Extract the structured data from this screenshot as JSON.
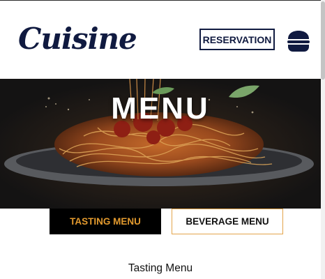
{
  "header": {
    "logo": "Cuisine",
    "reservation_label": "RESERVATION",
    "menu_icon": "hamburger-icon"
  },
  "hero": {
    "title": "MENU",
    "image": "spaghetti-plate-image"
  },
  "tabs": [
    {
      "label": "TASTING MENU",
      "active": true
    },
    {
      "label": "BEVERAGE MENU",
      "active": false
    }
  ],
  "section": {
    "heading": "Tasting Menu"
  },
  "colors": {
    "navy": "#101a40",
    "accent": "#e39a2e",
    "tab_border": "#e3a44a",
    "hero_bg": "#161515"
  }
}
